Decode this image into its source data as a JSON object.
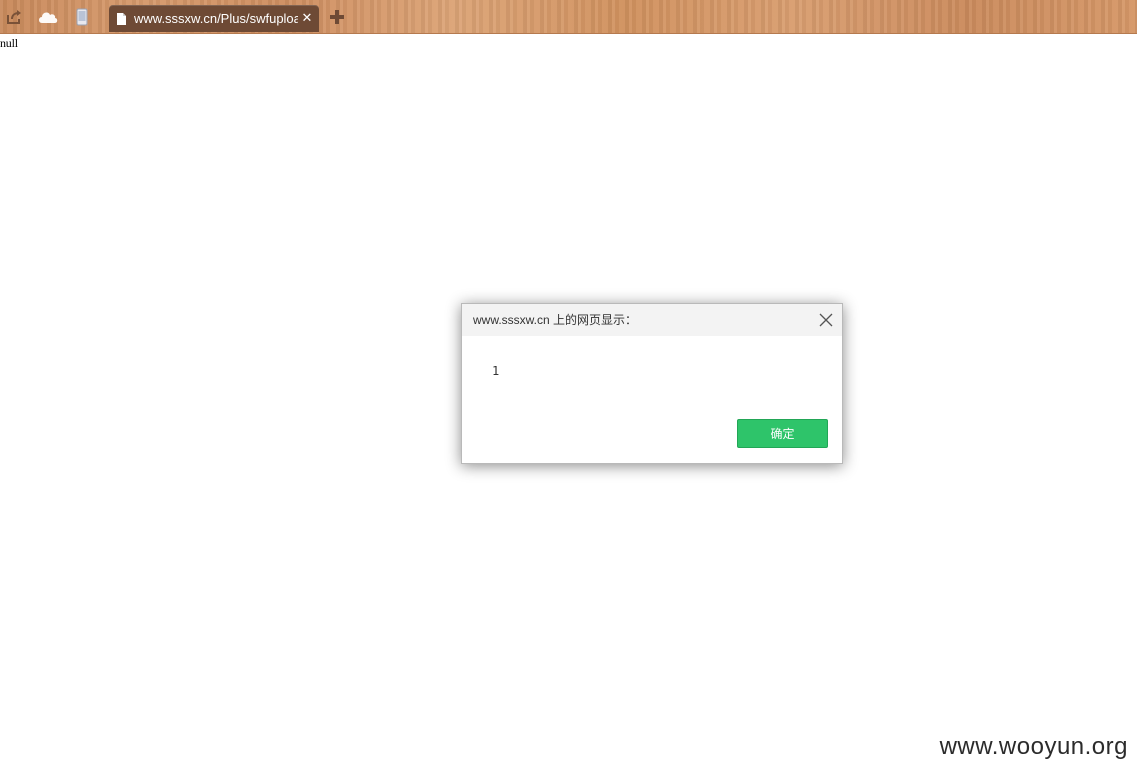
{
  "toolbar": {
    "icons": [
      "share-icon",
      "cloud-icon",
      "mobile-icon"
    ],
    "tab": {
      "title": "www.sssxw.cn/Plus/swfupload/swfupload.swf",
      "close_label": "✕",
      "icon": "document-icon"
    },
    "new_tab_icon": "plus-icon"
  },
  "page": {
    "body_text": "null"
  },
  "dialog": {
    "title": "www.sssxw.cn 上的网页显示：",
    "message": "1",
    "ok_label": "确定",
    "close_icon": "close-icon",
    "colors": {
      "ok_button": "#2ec46a",
      "header": "#f3f3f3"
    }
  },
  "watermark": {
    "text": "www.wooyun.org"
  },
  "colors": {
    "toolbar_wood": "#d39566",
    "tab_background": "#6e4a35"
  }
}
